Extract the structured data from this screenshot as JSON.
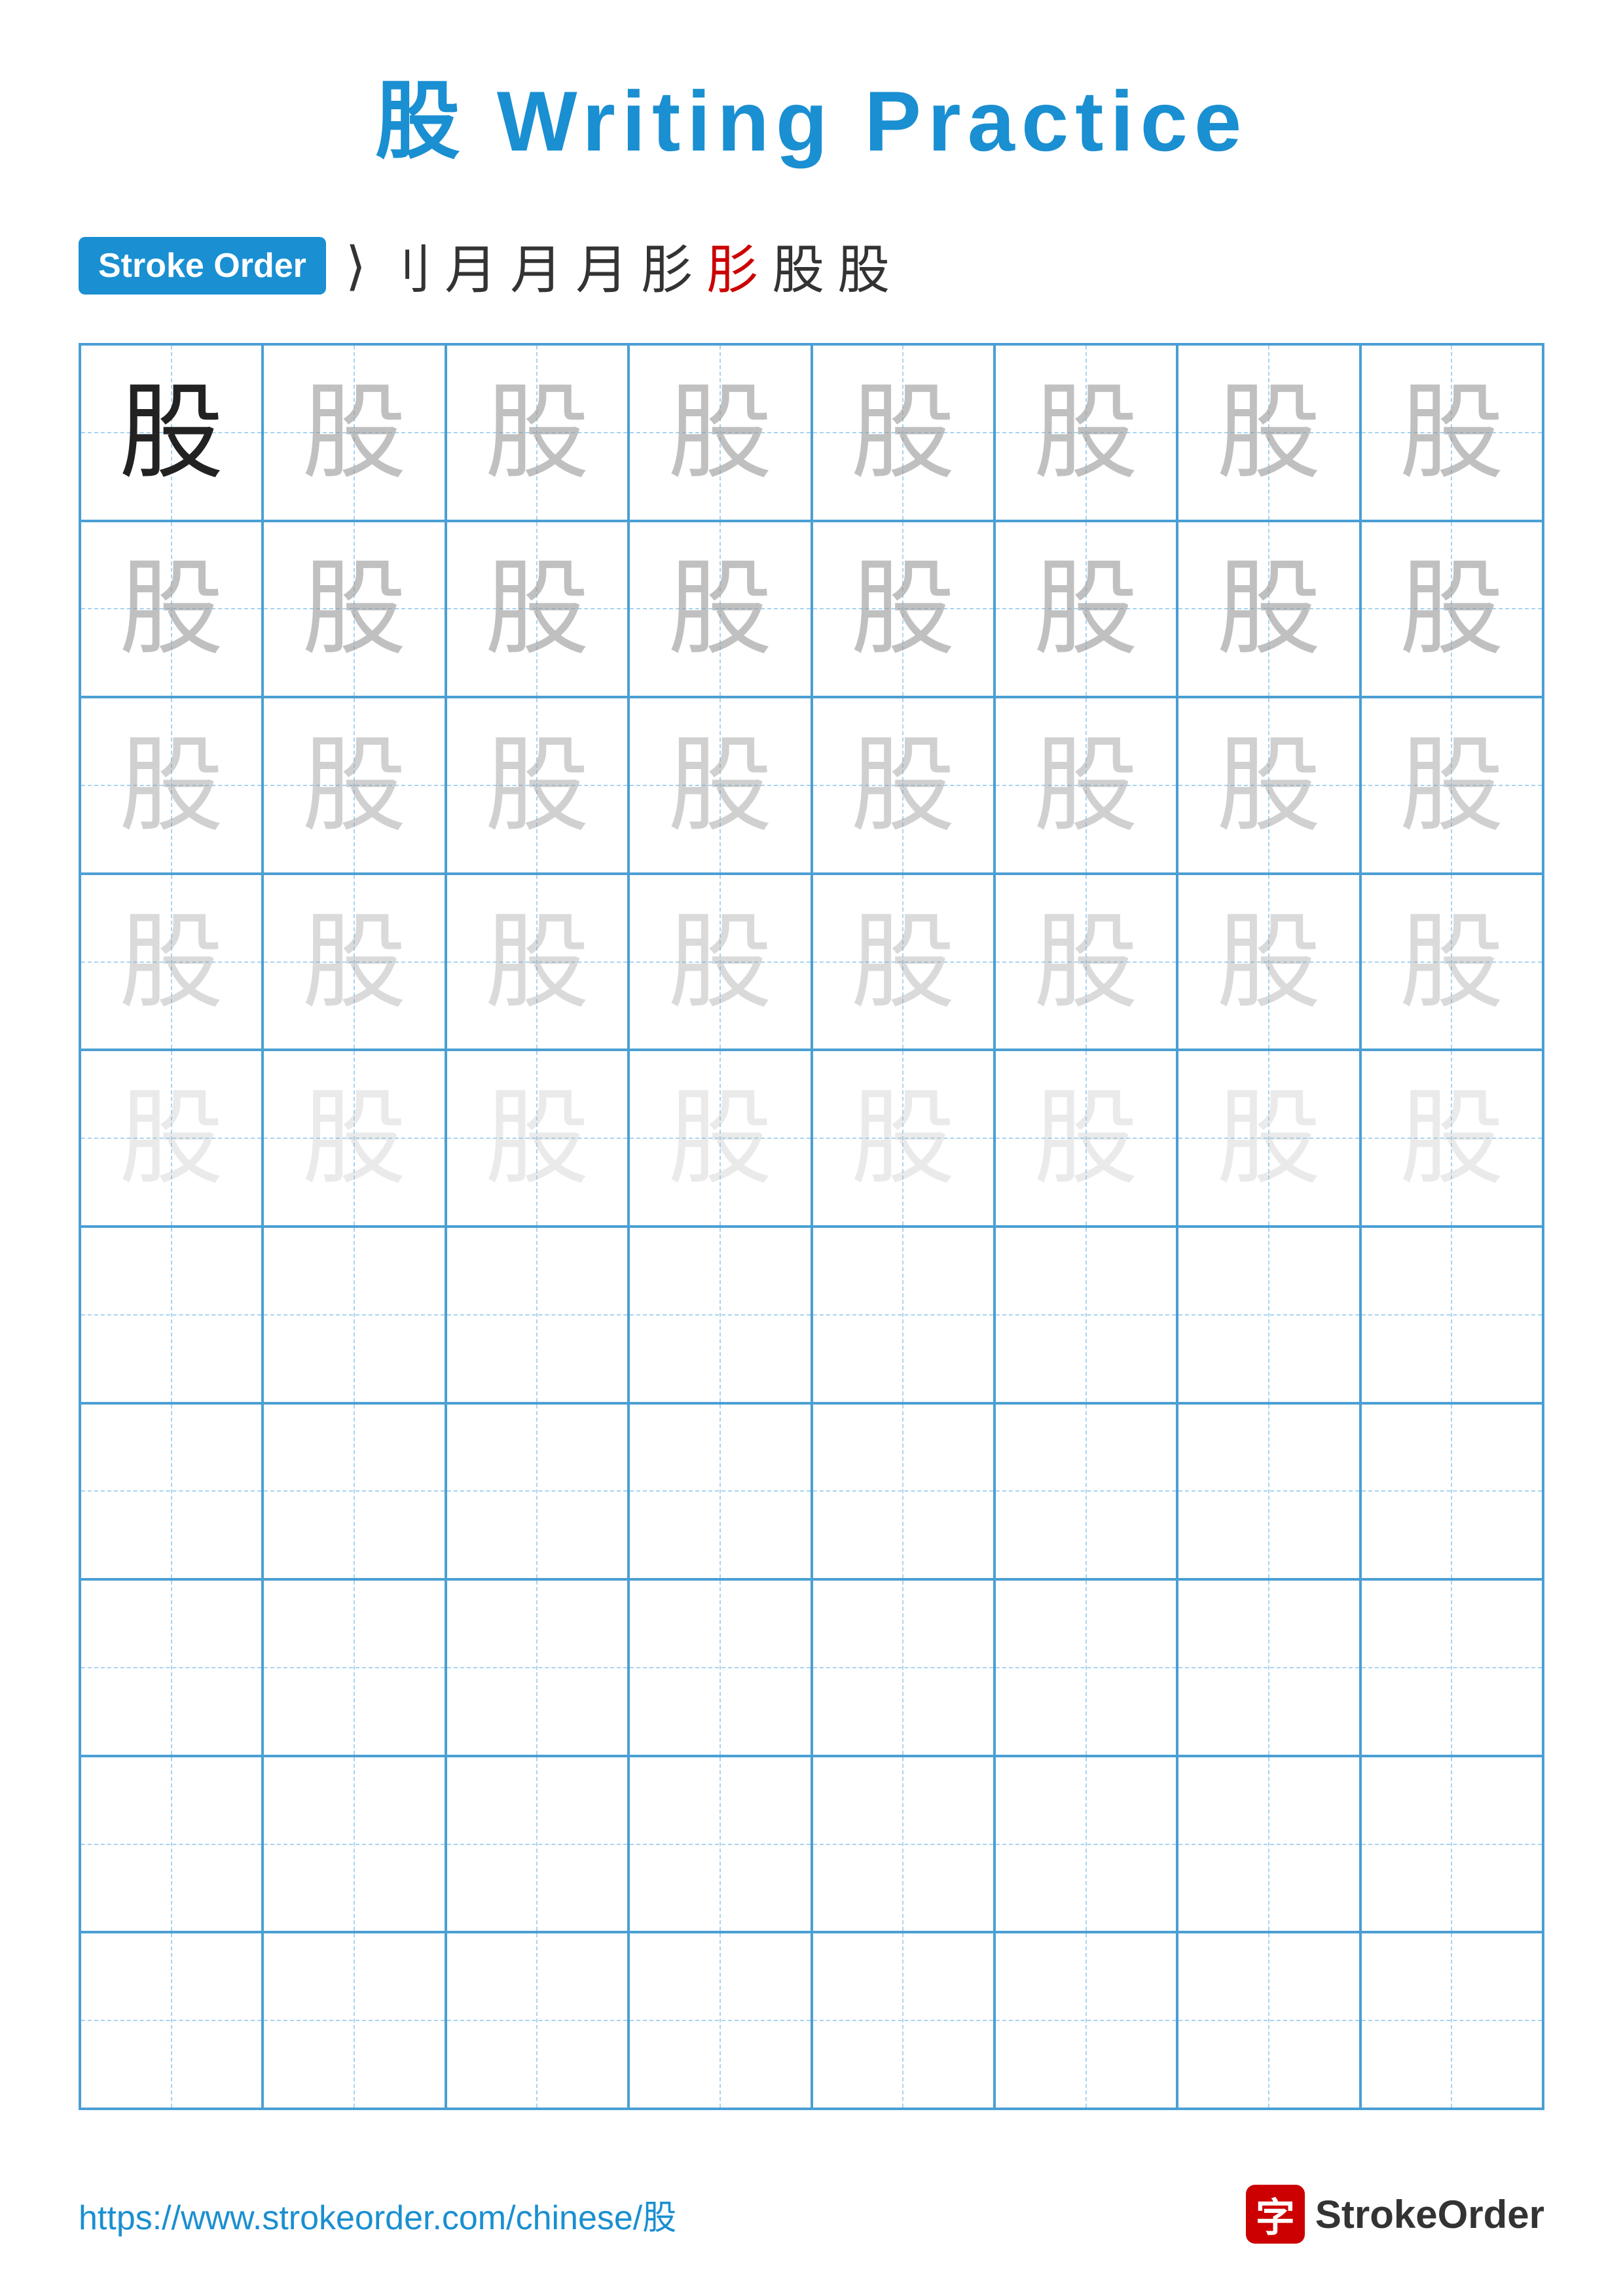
{
  "title": "股 Writing Practice",
  "stroke_order": {
    "badge_label": "Stroke Order",
    "sequence": [
      "⟩",
      "刂",
      "月",
      "月",
      "月",
      "肜",
      "肜",
      "股",
      "股"
    ]
  },
  "character": "股",
  "grid": {
    "rows": 10,
    "cols": 8
  },
  "footer": {
    "url": "https://www.strokeorder.com/chinese/股",
    "logo_char": "字",
    "logo_text": "StrokeOrder"
  }
}
